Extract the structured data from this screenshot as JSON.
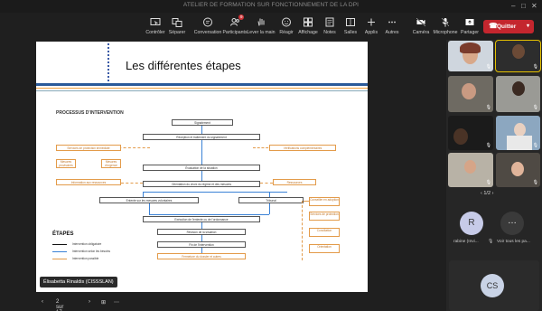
{
  "window": {
    "title": "ATELIER DE FORMATION SUR FONCTIONNEMENT DE LA DPI"
  },
  "toolbar": {
    "controller": "Contrôler",
    "separate": "Séparer",
    "conversation": "Conversation",
    "participants": "Participants",
    "participants_count": "9",
    "raise_hand": "Lever la main",
    "react": "Réagir",
    "view": "Affichage",
    "notes": "Notes",
    "rooms": "Salles",
    "apps": "Applis",
    "more": "Autres",
    "camera": "Caméra",
    "mic": "Microphone",
    "share": "Partager",
    "leave": "Quitter"
  },
  "slide": {
    "title": "Les différentes étapes",
    "diagram_title": "PROCESSUS D'INTERVENTION",
    "boxes": {
      "b1": "Signalement",
      "b2": "Réception et traitement du signalement",
      "b3": "Évaluation de la situation",
      "b4": "Orientation du choix du régime et des mesures",
      "b5": "Entente sur les mesures volontaires",
      "b6": "Tribunal",
      "b7": "Exécution de l'entente ou de l'ordonnance",
      "b8": "Révision de la situation",
      "b9": "Fin de l'intervention",
      "o1": "Services de protection immédiate",
      "o2": "Vérifications complémentaires",
      "o3": "Information aux ressources",
      "o4": "Ressources",
      "o5": "Mesures provisoires",
      "o6": "Mesures d'urgence",
      "o7": "Conseiller en adoption",
      "o8": "Services de protection",
      "o9": "Conciliation",
      "o10": "Orientation",
      "o11": "Autres types de recours",
      "o12": "Fermeture du dossier et autres"
    },
    "legend": {
      "title": "ÉTAPES",
      "row1": "Intervention obligatoire",
      "row2": "Intervention selon les besoins",
      "row3": "Intervention possible"
    }
  },
  "presenter": {
    "name": "Élisabetta Rinaldis (CISSSLAN)"
  },
  "nav": {
    "page": "2 sur 17"
  },
  "panel": {
    "pager": "1/2",
    "avatar_initial": "R",
    "participant_name": "rabine (Invi...",
    "see_all": "Voir tous les pa...",
    "cs_initials": "CS"
  }
}
